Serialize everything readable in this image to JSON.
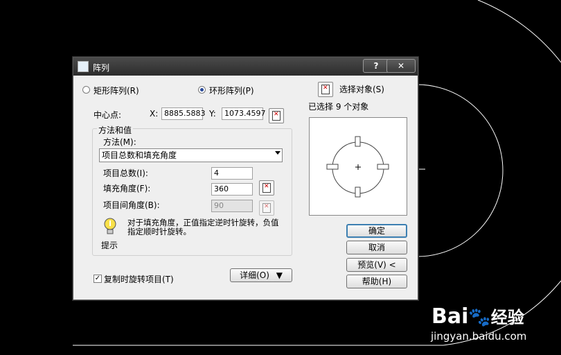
{
  "dialog": {
    "title": "阵列",
    "help_button": "?",
    "close_button": "✕",
    "rect_array_label": "矩形阵列(R)",
    "polar_array_label": "环形阵列(P)",
    "select_objects_label": "选择对象(S)",
    "selected_count_text": "已选择 9 个对象",
    "center_label": "中心点:",
    "x_label": "X:",
    "x_value": "8885.5883",
    "y_label": "Y:",
    "y_value": "1073.4597",
    "group_title": "方法和值",
    "method_label": "方法(M):",
    "method_value": "项目总数和填充角度",
    "total_items_label": "项目总数(I):",
    "total_items_value": "4",
    "fill_angle_label": "填充角度(F):",
    "fill_angle_value": "360",
    "item_angle_label": "项目间角度(B):",
    "item_angle_value": "90",
    "tip_text": "对于填充角度，正值指定逆时针旋转，负值指定顺时针旋转。",
    "tip_label": "提示",
    "rotate_items_label": "复制时旋转项目(T)",
    "rotate_items_checked": true,
    "details_button": "详细(O)",
    "ok_button": "确定",
    "cancel_button": "取消",
    "preview_button": "预览(V) <",
    "help_button_label": "帮助(H)"
  },
  "watermark": {
    "brand": "Bai",
    "brand_suffix": "经验",
    "url": "jingyan.baidu.com"
  }
}
